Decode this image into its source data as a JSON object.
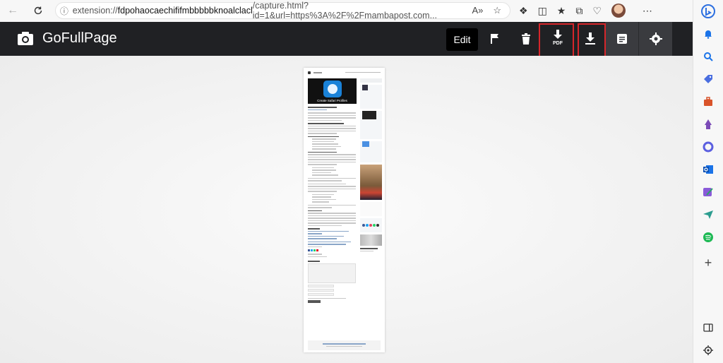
{
  "browser": {
    "url_prefix": "extension://",
    "url_host": "fdpohaocaechififmbbbbbknoalclacl",
    "url_path": "/capture.html?id=1&url=https%3A%2F%2Fmambapost.com...",
    "read_aloud_label": "A»"
  },
  "app": {
    "title": "GoFullPage",
    "edit_label": "Edit",
    "pdf_label": "PDF",
    "accent_color": "#202124",
    "highlight_color": "#d6262b"
  },
  "preview": {
    "hero_caption": "Create Safari Profiles"
  },
  "icons": [
    "back-icon",
    "refresh-icon",
    "info-icon",
    "read-aloud-icon",
    "favorite-icon",
    "extensions-icon",
    "split-screen-icon",
    "favorites-icon",
    "collections-icon",
    "health-icon",
    "profile-avatar",
    "more-icon",
    "bing-icon",
    "camera-icon",
    "flag-icon",
    "trash-icon",
    "download-pdf-icon",
    "download-image-icon",
    "document-icon",
    "settings-icon",
    "bell-icon",
    "search-icon",
    "shopping-tag-icon",
    "toolbox-icon",
    "games-icon",
    "copilot-icon",
    "outlook-icon",
    "designer-icon",
    "send-icon",
    "spotify-icon",
    "add-icon",
    "sidebar-toggle-icon",
    "sidebar-settings-icon"
  ]
}
